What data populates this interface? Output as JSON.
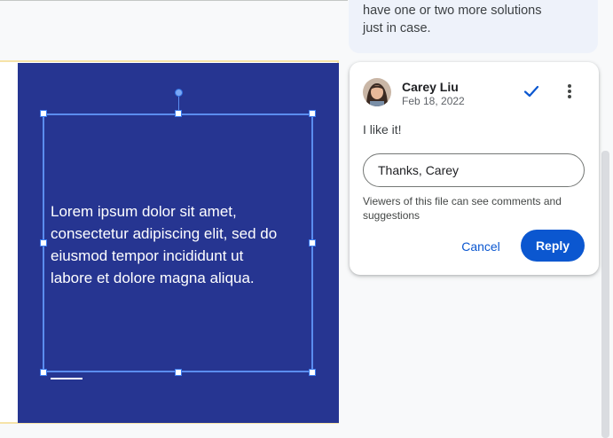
{
  "slide": {
    "text": "Lorem ipsum dolor sit amet,\nconsectetur adipiscing elit, sed do\neiusmod tempor incididunt ut\nlabore et dolore magna aliqua."
  },
  "previous_comment": {
    "text": "have one or two more solutions\njust in case."
  },
  "comment": {
    "author": "Carey Liu",
    "date": "Feb 18, 2022",
    "text": "I like it!",
    "reply_value": "Thanks, Carey",
    "visibility_note": "Viewers of this file can see comments and suggestions",
    "cancel_label": "Cancel",
    "reply_label": "Reply",
    "resolve_icon": "check-icon",
    "more_icon": "more-vert-icon"
  },
  "colors": {
    "slide_bg": "#263591",
    "accent": "#0b57d0",
    "selection": "#5b8def"
  }
}
